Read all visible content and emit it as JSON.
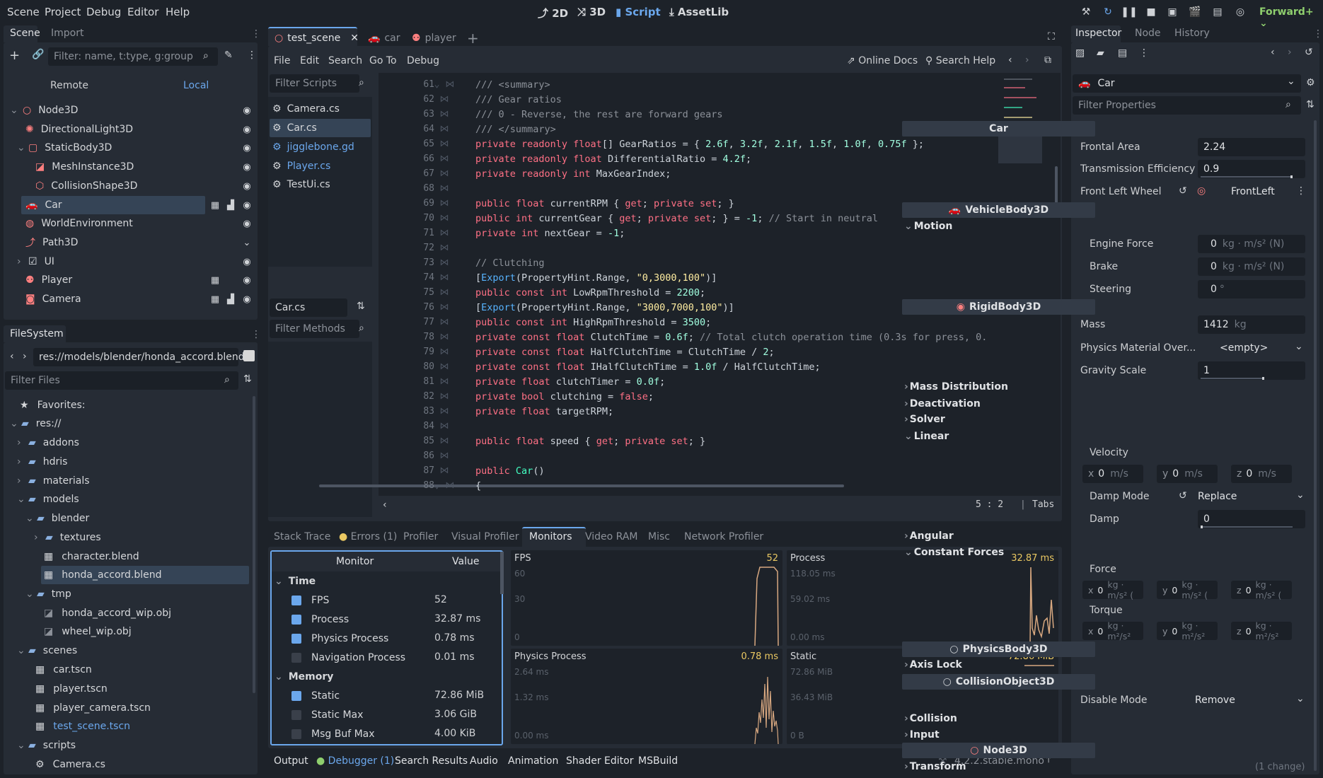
{
  "menu": {
    "scene": "Scene",
    "project": "Project",
    "debug": "Debug",
    "editor": "Editor",
    "help": "Help"
  },
  "workspaces": {
    "w2d": "2D",
    "w3d": "3D",
    "script": "Script",
    "assetlib": "AssetLib"
  },
  "renderer": "Forward+",
  "scene_dock": {
    "tab_scene": "Scene",
    "tab_import": "Import",
    "filter_placeholder": "Filter: name, t:type, g:group",
    "remote": "Remote",
    "local": "Local",
    "nodes": [
      {
        "label": "Node3D"
      },
      {
        "label": "DirectionalLight3D"
      },
      {
        "label": "StaticBody3D"
      },
      {
        "label": "MeshInstance3D"
      },
      {
        "label": "CollisionShape3D"
      },
      {
        "label": "Car"
      },
      {
        "label": "WorldEnvironment"
      },
      {
        "label": "Path3D"
      },
      {
        "label": "UI"
      },
      {
        "label": "Player"
      },
      {
        "label": "Camera"
      }
    ]
  },
  "filesystem": {
    "tab": "FileSystem",
    "path": "res://models/blender/honda_accord.blend",
    "filter_placeholder": "Filter Files",
    "favorites": "Favorites:",
    "items": [
      {
        "label": "res://"
      },
      {
        "label": "addons"
      },
      {
        "label": "hdris"
      },
      {
        "label": "materials"
      },
      {
        "label": "models"
      },
      {
        "label": "blender"
      },
      {
        "label": "textures"
      },
      {
        "label": "character.blend"
      },
      {
        "label": "honda_accord.blend"
      },
      {
        "label": "tmp"
      },
      {
        "label": "honda_accord_wip.obj"
      },
      {
        "label": "wheel_wip.obj"
      },
      {
        "label": "scenes"
      },
      {
        "label": "car.tscn"
      },
      {
        "label": "player.tscn"
      },
      {
        "label": "player_camera.tscn"
      },
      {
        "label": "test_scene.tscn"
      },
      {
        "label": "scripts"
      },
      {
        "label": "Camera.cs"
      }
    ]
  },
  "editor_tabs": [
    {
      "label": "test_scene"
    },
    {
      "label": "car"
    },
    {
      "label": "player"
    }
  ],
  "script_menu": {
    "file": "File",
    "edit": "Edit",
    "search": "Search",
    "goto": "Go To",
    "debug": "Debug",
    "online_docs": "Online Docs",
    "search_help": "Search Help"
  },
  "scripts_panel": {
    "filter_placeholder": "Filter Scripts",
    "scripts": [
      {
        "label": "Camera.cs"
      },
      {
        "label": "Car.cs"
      },
      {
        "label": "jigglebone.gd"
      },
      {
        "label": "Player.cs"
      },
      {
        "label": "TestUi.cs"
      }
    ],
    "current": "Car.cs",
    "methods_placeholder": "Filter Methods"
  },
  "code": {
    "line_numbers": [
      "61",
      "62",
      "63",
      "64",
      "65",
      "66",
      "67",
      "68",
      "69",
      "70",
      "71",
      "72",
      "73",
      "74",
      "75",
      "76",
      "77",
      "78",
      "79",
      "80",
      "81",
      "82",
      "83",
      "84",
      "85",
      "86",
      "87",
      "88"
    ],
    "status_pos": "5 :    2",
    "status_indent": "Tabs"
  },
  "bottom_tabs": {
    "stack_trace": "Stack Trace",
    "errors": "Errors (1)",
    "profiler": "Profiler",
    "visual_profiler": "Visual Profiler",
    "monitors": "Monitors",
    "video_ram": "Video RAM",
    "misc": "Misc",
    "network_profiler": "Network Profiler"
  },
  "monitors": {
    "col_monitor": "Monitor",
    "col_value": "Value",
    "time_group": "Time",
    "memory_group": "Memory",
    "rows": [
      {
        "name": "FPS",
        "value": "52",
        "checked": true
      },
      {
        "name": "Process",
        "value": "32.87 ms",
        "checked": true
      },
      {
        "name": "Physics Process",
        "value": "0.78 ms",
        "checked": true
      },
      {
        "name": "Navigation Process",
        "value": "0.01 ms",
        "checked": false
      },
      {
        "name": "Static",
        "value": "72.86 MiB",
        "checked": true
      },
      {
        "name": "Static Max",
        "value": "3.06 GiB",
        "checked": false
      },
      {
        "name": "Msg Buf Max",
        "value": "4.00 KiB",
        "checked": false
      }
    ],
    "graphs": [
      {
        "title": "FPS",
        "value": "52",
        "ticks": [
          "60",
          "30",
          "0"
        ]
      },
      {
        "title": "Process",
        "value": "32.87 ms",
        "ticks": [
          "118.05 ms",
          "59.02 ms",
          "0.00 ms"
        ]
      },
      {
        "title": "Physics Process",
        "value": "0.78 ms",
        "ticks": [
          "2.64 ms",
          "1.32 ms",
          "0.00 ms"
        ]
      },
      {
        "title": "Static",
        "value": "72.86 MiB",
        "ticks": [
          "72.86 MiB",
          "36.43 MiB",
          "0 B"
        ]
      }
    ]
  },
  "bottom_bar": {
    "output": "Output",
    "debugger": "Debugger (1)",
    "search_results": "Search Results",
    "audio": "Audio",
    "animation": "Animation",
    "shader_editor": "Shader Editor",
    "msbuild": "MSBuild",
    "version": "4.2.2.stable.mono"
  },
  "inspector": {
    "tab_inspector": "Inspector",
    "tab_node": "Node",
    "tab_history": "History",
    "object": "Car",
    "filter_placeholder": "Filter Properties",
    "class_car": "Car",
    "frontal_area_label": "Frontal Area",
    "frontal_area": "2.24",
    "trans_eff_label": "Transmission Efficiency",
    "trans_eff": "0.9",
    "front_left_label": "Front Left Wheel",
    "front_left": "FrontLeft",
    "class_vehicle": "VehicleBody3D",
    "motion": "Motion",
    "engine_force_label": "Engine Force",
    "engine_force": "0",
    "engine_unit": "kg · m/s² (N)",
    "brake_label": "Brake",
    "brake": "0",
    "brake_unit": "kg · m/s² (N)",
    "steering_label": "Steering",
    "steering": "0",
    "steering_unit": "°",
    "class_rigid": "RigidBody3D",
    "mass_label": "Mass",
    "mass": "1412",
    "mass_unit": "kg",
    "phys_mat_label": "Physics Material Over...",
    "phys_mat": "<empty>",
    "gravity_label": "Gravity Scale",
    "gravity": "1",
    "mass_dist": "Mass Distribution",
    "deactivation": "Deactivation",
    "solver": "Solver",
    "linear": "Linear",
    "velocity_label": "Velocity",
    "vel_x": "0",
    "vel_y": "0",
    "vel_z": "0",
    "vel_unit": "m/s",
    "damp_mode_label": "Damp Mode",
    "damp_mode": "Replace",
    "damp_label": "Damp",
    "damp": "0",
    "angular": "Angular",
    "const_forces": "Constant Forces",
    "force_label": "Force",
    "force_unit": "kg · m/s² (",
    "torque_label": "Torque",
    "torque_unit": "kg · m²/s²",
    "class_physics": "PhysicsBody3D",
    "axis_lock": "Axis Lock",
    "class_collision": "CollisionObject3D",
    "disable_mode_label": "Disable Mode",
    "disable_mode": "Remove",
    "collision": "Collision",
    "input": "Input",
    "class_node3d": "Node3D",
    "transform": "Transform",
    "transform_change": "(1 change)"
  }
}
